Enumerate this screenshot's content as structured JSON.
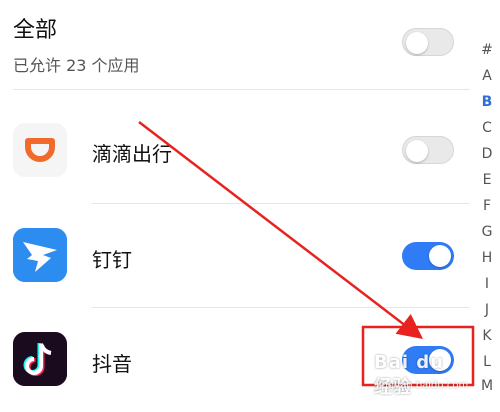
{
  "header": {
    "title": "全部",
    "subtitle": "已允许 23 个应用",
    "toggle_on": false
  },
  "apps": [
    {
      "name": "滴滴出行",
      "icon": "didi-icon",
      "enabled": false
    },
    {
      "name": "钉钉",
      "icon": "dingtalk-icon",
      "enabled": true
    },
    {
      "name": "抖音",
      "icon": "douyin-icon",
      "enabled": true
    }
  ],
  "index_letters": [
    "#",
    "A",
    "B",
    "C",
    "D",
    "E",
    "F",
    "G",
    "H",
    "I",
    "J",
    "K",
    "L",
    "M"
  ],
  "active_index": "B",
  "annotation": {
    "arrow_color": "#e8231f",
    "highlight_color": "#e8231f"
  },
  "watermark": {
    "logo": "Bai du 经验",
    "url": "jingyan.baidu.com"
  },
  "colors": {
    "toggle_on": "#2f7cf6",
    "toggle_off": "#e9e9e9",
    "index_active": "#2f6fd6"
  }
}
